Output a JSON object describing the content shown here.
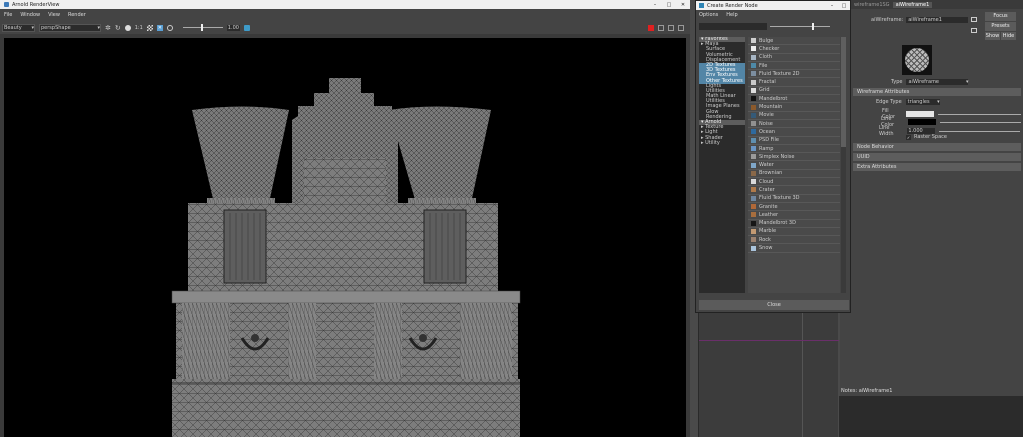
{
  "render_view": {
    "title": "Arnold RenderView",
    "menu": [
      "File",
      "Window",
      "View",
      "Render"
    ],
    "aov_select": "Beauty",
    "camera_select": "perspShape",
    "exposure_label": "1:1",
    "exposure_value": "1.00"
  },
  "create_node": {
    "title": "Create Render Node",
    "menu": [
      "Options",
      "Help"
    ],
    "categories": [
      {
        "label": "Favorites",
        "type": "header"
      },
      {
        "label": "Maya",
        "type": "group"
      },
      {
        "label": "Surface",
        "type": "item"
      },
      {
        "label": "Volumetric",
        "type": "item"
      },
      {
        "label": "Displacement",
        "type": "item"
      },
      {
        "label": "2D Textures",
        "type": "selected"
      },
      {
        "label": "3D Textures",
        "type": "selected"
      },
      {
        "label": "Env Textures",
        "type": "selected"
      },
      {
        "label": "Other Textures",
        "type": "selected"
      },
      {
        "label": "Lights",
        "type": "item"
      },
      {
        "label": "Utilities",
        "type": "item"
      },
      {
        "label": "Math Linear",
        "type": "item"
      },
      {
        "label": "Utilities",
        "type": "item"
      },
      {
        "label": "Image Planes",
        "type": "item"
      },
      {
        "label": "Glow",
        "type": "item"
      },
      {
        "label": "Rendering",
        "type": "item"
      },
      {
        "label": "Arnold",
        "type": "header"
      },
      {
        "label": "Texture",
        "type": "group"
      },
      {
        "label": "Light",
        "type": "group"
      },
      {
        "label": "Shader",
        "type": "group"
      },
      {
        "label": "Utility",
        "type": "group"
      }
    ],
    "nodes": [
      {
        "label": "Bulge",
        "color": "#cfcfcf"
      },
      {
        "label": "Checker",
        "color": "#eeeeee"
      },
      {
        "label": "Cloth",
        "color": "#a7b6c4"
      },
      {
        "label": "File",
        "color": "#4e8aa8"
      },
      {
        "label": "Fluid Texture 2D",
        "color": "#7c8ea0"
      },
      {
        "label": "Fractal",
        "color": "#c8c8c8"
      },
      {
        "label": "Grid",
        "color": "#dddddd"
      },
      {
        "label": "Mandelbrot",
        "color": "#111111"
      },
      {
        "label": "Mountain",
        "color": "#8c5a2c"
      },
      {
        "label": "Movie",
        "color": "#355a78"
      },
      {
        "label": "Noise",
        "color": "#909090"
      },
      {
        "label": "Ocean",
        "color": "#2f6a9f"
      },
      {
        "label": "PSD File",
        "color": "#5f8fb0"
      },
      {
        "label": "Ramp",
        "color": "#6a95c4"
      },
      {
        "label": "Simplex Noise",
        "color": "#9a9a9a"
      },
      {
        "label": "Water",
        "color": "#7fa7c9"
      },
      {
        "label": "Brownian",
        "color": "#8a6848"
      },
      {
        "label": "Cloud",
        "color": "#d9d9d9"
      },
      {
        "label": "Crater",
        "color": "#b07a4a"
      },
      {
        "label": "Fluid Texture 3D",
        "color": "#6e86a0"
      },
      {
        "label": "Granite",
        "color": "#b06838"
      },
      {
        "label": "Leather",
        "color": "#a86e3e"
      },
      {
        "label": "Mandelbrot 3D",
        "color": "#161616"
      },
      {
        "label": "Marble",
        "color": "#c39a73"
      },
      {
        "label": "Rock",
        "color": "#9c8270"
      },
      {
        "label": "Snow",
        "color": "#aac4dc"
      }
    ],
    "close_label": "Close"
  },
  "outliner": {
    "tabs": [
      "wireframe1SG",
      "aiWireframe1"
    ]
  },
  "attr_editor": {
    "node_label": "aiWireframe:",
    "node_name": "aiWireframe1",
    "focus_label": "Focus",
    "presets_label": "Presets",
    "show_label": "Show",
    "hide_label": "Hide",
    "type_label": "Type",
    "type_value": "aiWireframe",
    "section_title": "Wireframe Attributes",
    "edge_type_label": "Edge Type",
    "edge_type_value": "triangles",
    "fill_color_label": "Fill Color",
    "line_color_label": "Line Color",
    "line_width_label": "Line Width",
    "line_width_value": "1.000",
    "raster_space_label": "Raster Space",
    "collapsed_sections": [
      "Node Behavior",
      "UUID",
      "Extra Attributes"
    ],
    "notes_label": "Notes:  aiWireframe1"
  },
  "colors": {
    "accent": "#5285a6",
    "viewport_bg": "#000000",
    "panel_bg": "#444444"
  }
}
